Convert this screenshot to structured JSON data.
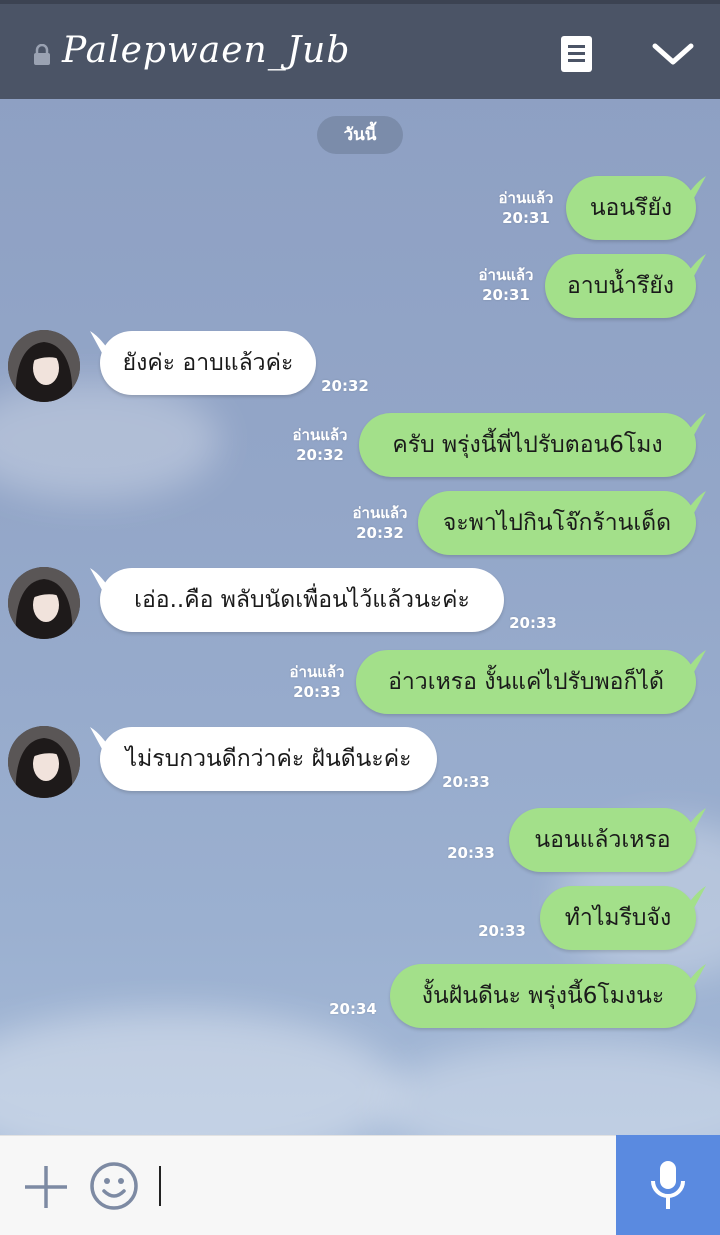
{
  "header": {
    "title": "Palepwaen_Jub",
    "lock_icon": "lock-icon",
    "menu_icon": "notes-icon",
    "collapse_icon": "chevron-down-icon"
  },
  "date_divider": "วันนี้",
  "colors": {
    "header_bg": "#4b5466",
    "my_bubble": "#a3e08a",
    "their_bubble": "#ffffff",
    "date_pill": "#7b8caa",
    "mic_button": "#5a8ae0"
  },
  "messages": [
    {
      "sender": "me",
      "text": "นอนรึยัง",
      "read": "อ่านแล้ว",
      "time": "20:31"
    },
    {
      "sender": "me",
      "text": "อาบน้ำรึยัง",
      "read": "อ่านแล้ว",
      "time": "20:31"
    },
    {
      "sender": "them",
      "text": "ยังค่ะ อาบแล้วค่ะ",
      "time": "20:32"
    },
    {
      "sender": "me",
      "text": "ครับ พรุ่งนี้พี่ไปรับตอน6โมง",
      "read": "อ่านแล้ว",
      "time": "20:32"
    },
    {
      "sender": "me",
      "text": "จะพาไปกินโจ๊กร้านเด็ด",
      "read": "อ่านแล้ว",
      "time": "20:32"
    },
    {
      "sender": "them",
      "text": "เอ่อ..คือ พลับนัดเพื่อนไว้แล้วนะค่ะ",
      "time": "20:33"
    },
    {
      "sender": "me",
      "text": "อ่าวเหรอ งั้นแค่ไปรับพอก็ได้",
      "read": "อ่านแล้ว",
      "time": "20:33"
    },
    {
      "sender": "them",
      "text": "ไม่รบกวนดีกว่าค่ะ ฝันดีนะค่ะ",
      "time": "20:33"
    },
    {
      "sender": "me",
      "text": "นอนแล้วเหรอ",
      "time": "20:33"
    },
    {
      "sender": "me",
      "text": "ทำไมรีบจัง",
      "time": "20:33"
    },
    {
      "sender": "me",
      "text": "งั้นฝันดีนะ พรุ่งนี้6โมงนะ",
      "time": "20:34"
    }
  ],
  "input": {
    "value": "",
    "add_icon": "plus-icon",
    "emoji_icon": "smiley-icon",
    "voice_icon": "microphone-icon"
  }
}
